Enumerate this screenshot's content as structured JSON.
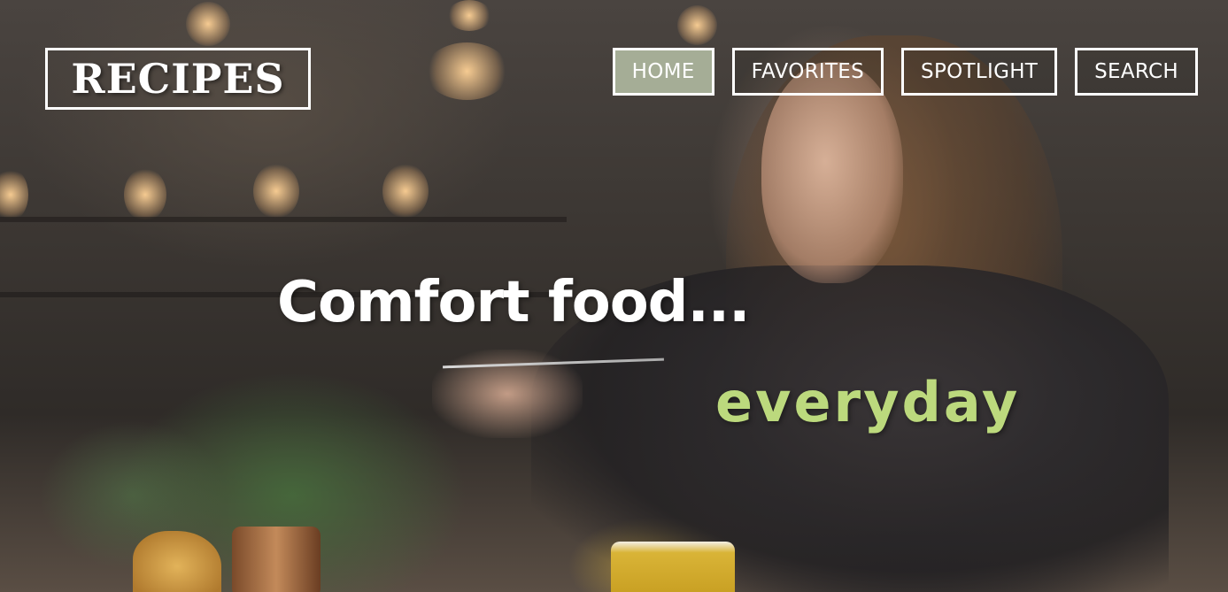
{
  "logo": {
    "text": "RECIPES"
  },
  "nav": {
    "items": [
      {
        "label": "HOME",
        "active": true
      },
      {
        "label": "FAVORITES",
        "active": false
      },
      {
        "label": "SPOTLIGHT",
        "active": false
      },
      {
        "label": "SEARCH",
        "active": false
      }
    ]
  },
  "hero": {
    "headline": "Comfort food...",
    "subheadline": "everyday"
  },
  "colors": {
    "active_nav_bg": "#a5ad96",
    "subheadline": "#bcd97d",
    "border": "#ffffff"
  }
}
